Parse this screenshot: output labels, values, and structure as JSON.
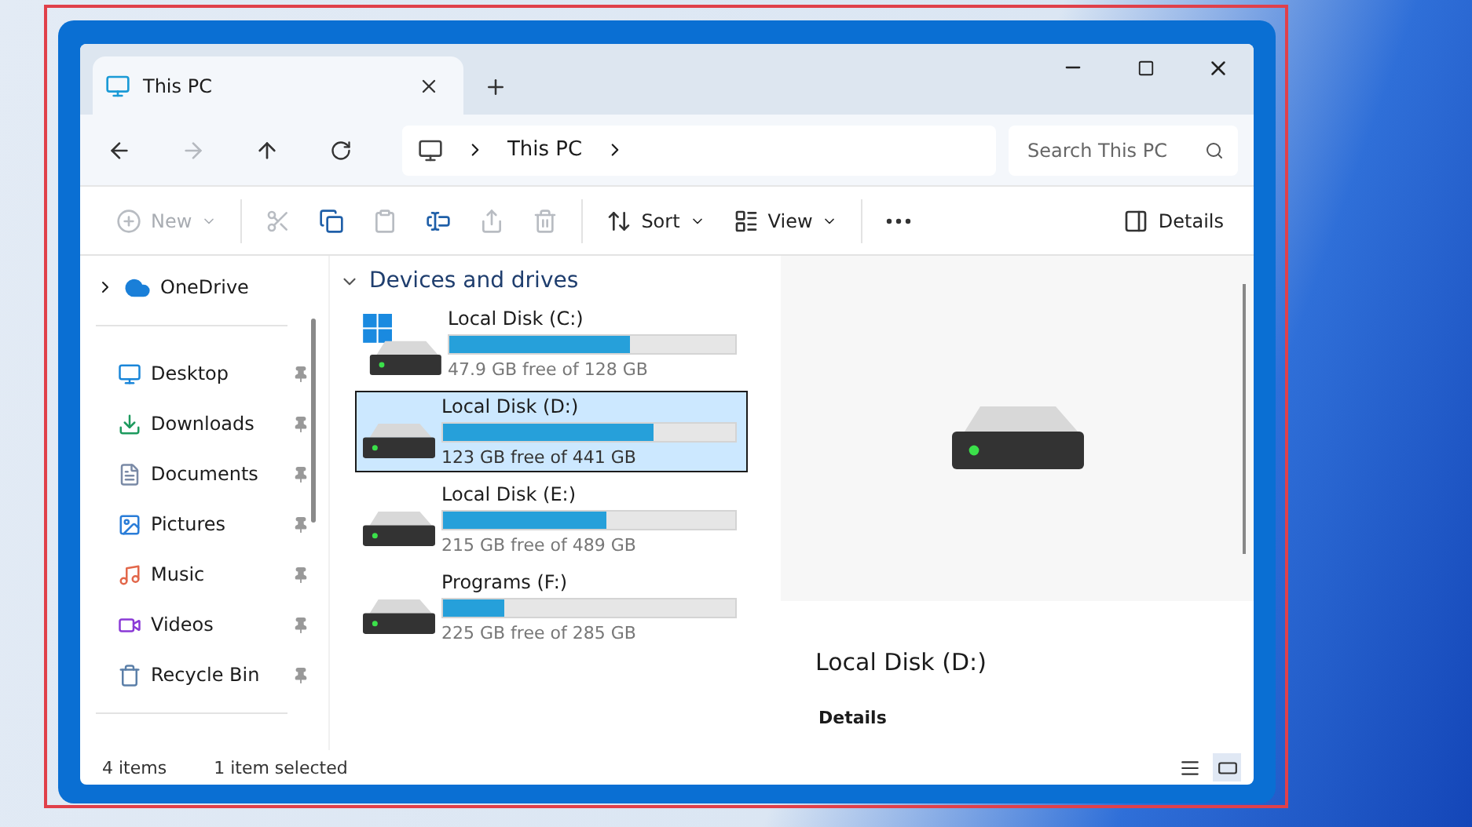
{
  "window": {
    "tab": {
      "title": "This PC",
      "selected": true
    }
  },
  "address": {
    "crumbs": [
      "This PC"
    ]
  },
  "search": {
    "placeholder": "Search This PC"
  },
  "toolbar": [
    {
      "kind": "new",
      "label": "New",
      "disabled": true
    },
    {
      "kind": "cut",
      "disabled": true
    },
    {
      "kind": "copy",
      "disabled": false
    },
    {
      "kind": "paste",
      "disabled": true
    },
    {
      "kind": "rename",
      "disabled": false
    },
    {
      "kind": "share",
      "disabled": true
    },
    {
      "kind": "delete",
      "disabled": true
    },
    {
      "kind": "sort",
      "label": "Sort",
      "disabled": false
    },
    {
      "kind": "view",
      "label": "View",
      "disabled": false
    },
    {
      "kind": "more",
      "disabled": false
    },
    {
      "kind": "details",
      "label": "Details",
      "disabled": false
    }
  ],
  "sidebar": {
    "top": [
      {
        "label": "OneDrive",
        "expanded": false
      }
    ],
    "items": [
      {
        "kind": "desktop",
        "label": "Desktop",
        "pinned": true
      },
      {
        "kind": "downloads",
        "label": "Downloads",
        "pinned": true
      },
      {
        "kind": "documents",
        "label": "Documents",
        "pinned": true
      },
      {
        "kind": "pictures",
        "label": "Pictures",
        "pinned": true
      },
      {
        "kind": "music",
        "label": "Music",
        "pinned": true
      },
      {
        "kind": "videos",
        "label": "Videos",
        "pinned": true
      },
      {
        "kind": "recycle",
        "label": "Recycle Bin",
        "pinned": true
      }
    ]
  },
  "section": {
    "title": "Devices and drives",
    "expanded": true
  },
  "drives": [
    {
      "kind": "system",
      "name": "Local Disk (C:)",
      "free": "47.9 GB free of 128 GB",
      "level": 0.63,
      "selected": false
    },
    {
      "kind": "drive",
      "name": "Local Disk (D:)",
      "free": "123 GB free of 441 GB",
      "level": 0.72,
      "selected": true
    },
    {
      "kind": "drive",
      "name": "Local Disk (E:)",
      "free": "215 GB free of 489 GB",
      "level": 0.56,
      "selected": false
    },
    {
      "kind": "drive",
      "name": "Programs (F:)",
      "free": "225 GB free of 285 GB",
      "level": 0.21,
      "selected": false
    }
  ],
  "details_pane": {
    "title": "Local Disk (D:)",
    "section": "Details"
  },
  "status_bar": {
    "count": "4 items",
    "selection": "1 item selected",
    "views": [
      {
        "kind": "details",
        "selected": false
      },
      {
        "kind": "tiles",
        "selected": true
      }
    ]
  }
}
